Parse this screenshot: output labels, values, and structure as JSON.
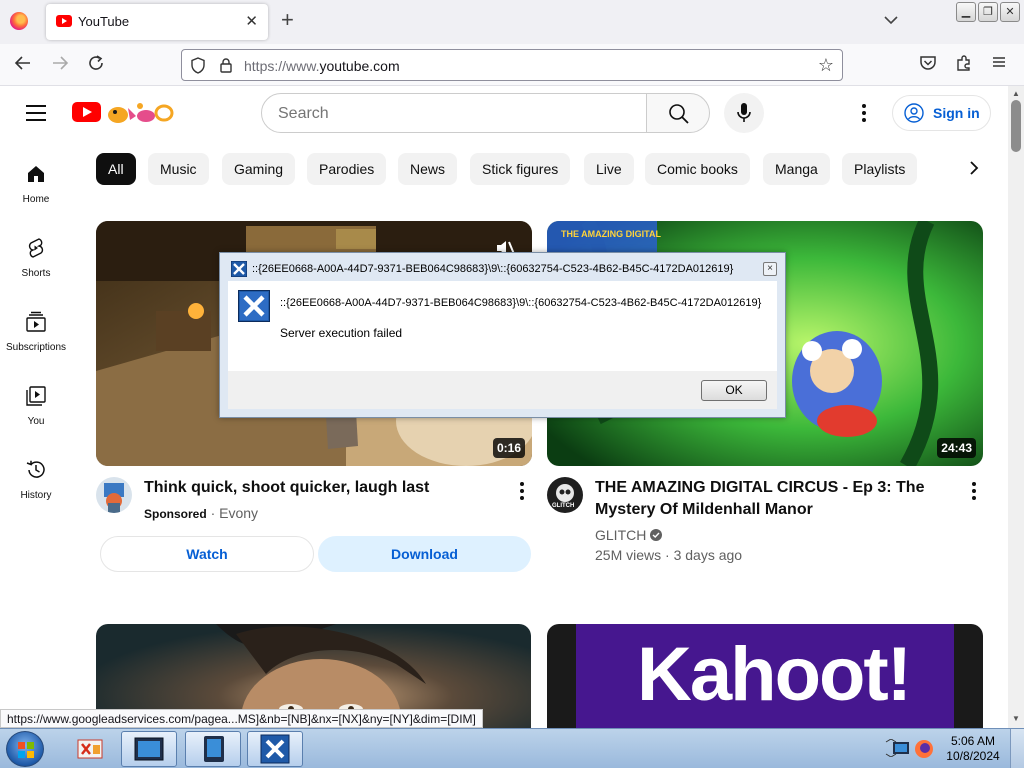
{
  "browser": {
    "tab_title": "YouTube",
    "url_prefix": "https://www.",
    "url_domain": "youtube.com",
    "window_buttons": [
      "minimize",
      "restore",
      "close"
    ]
  },
  "youtube": {
    "search_placeholder": "Search",
    "sign_in": "Sign in",
    "sidebar": [
      {
        "label": "Home",
        "icon": "home-icon"
      },
      {
        "label": "Shorts",
        "icon": "shorts-icon"
      },
      {
        "label": "Subscriptions",
        "icon": "subscriptions-icon"
      },
      {
        "label": "You",
        "icon": "you-icon"
      },
      {
        "label": "History",
        "icon": "history-icon"
      }
    ],
    "chips": [
      "All",
      "Music",
      "Gaming",
      "Parodies",
      "News",
      "Stick figures",
      "Live",
      "Comic books",
      "Manga",
      "Playlists"
    ],
    "videos": [
      {
        "title": "Think quick, shoot quicker, laugh last",
        "sponsored": "Sponsored",
        "separator": "·",
        "advertiser": "Evony",
        "duration": "0:16",
        "watch_label": "Watch",
        "download_label": "Download"
      },
      {
        "title_line1": "THE AMAZING DIGITAL CIRCUS - Ep 3: The",
        "title_line2": "Mystery Of Mildenhall Manor",
        "channel": "GLITCH",
        "views": "25M views",
        "separator": "·",
        "age": "3 days ago",
        "duration": "24:43"
      }
    ],
    "thumbnail_text": {
      "circus": "THE AMAZING DIGITAL",
      "glitch_badge": "GLITCH",
      "kahoot": "Kahoot!"
    }
  },
  "status_link": "https://www.googleadservices.com/pagea...MS]&nb=[NB]&nx=[NX]&ny=[NY]&dim=[DIM]",
  "dialog": {
    "title": "::{26EE0668-A00A-44D7-9371-BEB064C98683}\\9\\::{60632754-C523-4B62-B45C-4172DA012619}",
    "message_path": "::{26EE0668-A00A-44D7-9371-BEB064C98683}\\9\\::{60632754-C523-4B62-B45C-4172DA012619}",
    "message": "Server execution failed",
    "ok_label": "OK",
    "close_glyph": "×"
  },
  "taskbar": {
    "time": "5:06 AM",
    "date": "10/8/2024"
  },
  "colors": {
    "youtube_red": "#ff0000",
    "link_blue": "#065fd4",
    "kahoot_purple": "#46178f",
    "dialog_blue": "#1f5aa8"
  }
}
